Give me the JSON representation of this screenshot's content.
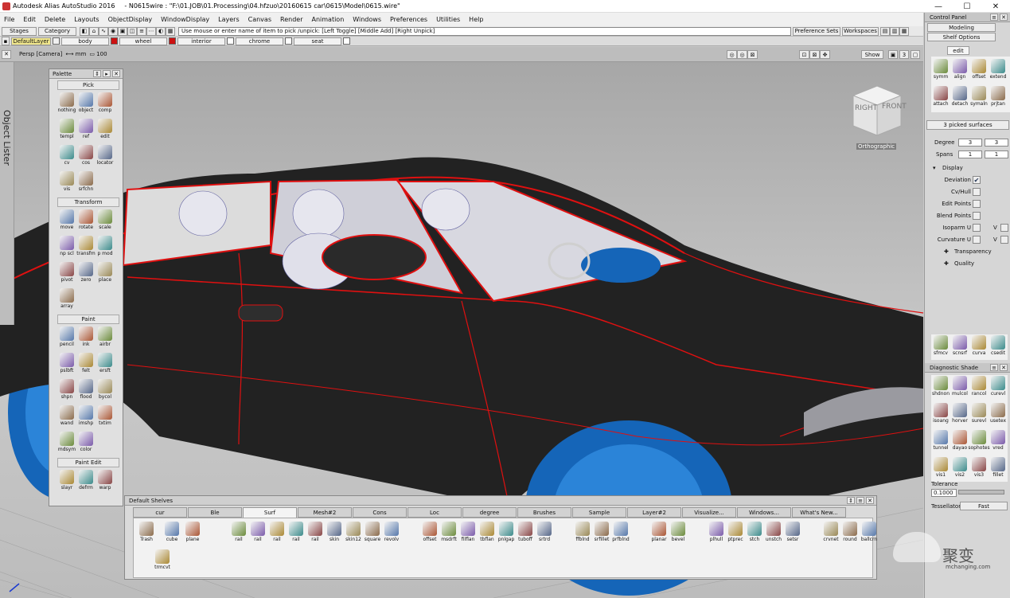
{
  "window": {
    "app_title": "Autodesk Alias AutoStudio 2016",
    "file_title": "- N0615wire : \"F:\\01.JOB\\01.Processing\\04.hfzuo\\20160615 car\\0615\\Model\\0615.wire\"",
    "minimize": "—",
    "maximize": "☐",
    "close": "✕"
  },
  "menu": [
    "File",
    "Edit",
    "Delete",
    "Layouts",
    "ObjectDisplay",
    "WindowDisplay",
    "Layers",
    "Canvas",
    "Render",
    "Animation",
    "Windows",
    "Preferences",
    "Utilities",
    "Help"
  ],
  "toolbar": {
    "stages": "Stages",
    "category": "Category",
    "pick_prompt": "Use mouse or enter name of item to pick /unpick: [Left Toggle] [Middle Add] [Right Unpick]",
    "preference_sets": "Preference Sets",
    "workspaces": "Workspaces"
  },
  "layers": [
    {
      "name": "DefaultLayer",
      "color": "#f0e68c"
    },
    {
      "name": "body",
      "color": "#cc1111"
    },
    {
      "name": "wheel",
      "color": "#cc1111"
    },
    {
      "name": "interior",
      "color": "#ffffff"
    },
    {
      "name": "chrome",
      "color": "#ffffff"
    },
    {
      "name": "seat",
      "color": "#ffffff"
    }
  ],
  "viewport": {
    "camera": "Persp [Camera]",
    "units": "mm",
    "zoom": "100",
    "show_button": "Show",
    "layout_num": "3",
    "viewcube_right": "RIGHT",
    "viewcube_front": "FRONT",
    "view_mode": "Orthographic",
    "colors": {
      "car_body": "#1e1e1e",
      "wire": "#e01010",
      "wheel": "#1e6fc8",
      "seat": "#d8d8e0"
    }
  },
  "object_lister": "Object Lister",
  "palette": {
    "title": "Palette",
    "sections": [
      {
        "name": "Pick",
        "items": [
          "nothing",
          "object",
          "comp",
          "templ",
          "ref",
          "edit",
          "cv",
          "cos",
          "locator",
          "vis",
          "srfchn"
        ]
      },
      {
        "name": "Transform",
        "items": [
          "move",
          "rotate",
          "scale",
          "np scl",
          "transfm",
          "p mod",
          "pivot",
          "zero",
          "place",
          "array"
        ]
      },
      {
        "name": "Paint",
        "items": [
          "pencil",
          "ink",
          "airbr",
          "pslbft",
          "felt",
          "ersft",
          "shpn",
          "flood",
          "bycol",
          "wand",
          "imshp",
          "txtim",
          "mdsym",
          "color"
        ]
      },
      {
        "name": "Paint Edit",
        "items": [
          "slayr",
          "defrm",
          "warp"
        ]
      }
    ]
  },
  "control_panel": {
    "title": "Control Panel",
    "modeling": "Modeling",
    "shelf_options": "Shelf Options",
    "edit_tab": "edit",
    "edit_items": [
      "symm",
      "align",
      "offset",
      "extend",
      "attach",
      "detach",
      "symaln",
      "prjtan"
    ],
    "picked": "3 picked surfaces",
    "degree_label": "Degree",
    "degree_u": "3",
    "degree_v": "3",
    "spans_label": "Spans",
    "spans_u": "1",
    "spans_v": "1",
    "display_label": "Display",
    "display_rows": [
      {
        "label": "Deviation",
        "checked": true,
        "v": false
      },
      {
        "label": "Cv/Hull",
        "checked": false,
        "v": false
      },
      {
        "label": "Edit Points",
        "checked": false,
        "v": false
      },
      {
        "label": "Blend Points",
        "checked": false,
        "v": false
      },
      {
        "label": "Isoparm U",
        "checked": false,
        "v": true
      },
      {
        "label": "Curvature U",
        "checked": false,
        "v": true
      }
    ],
    "v_label": "V",
    "transparency": "Transparency",
    "quality": "Quality",
    "tools_items": [
      "sfmcv",
      "scnsrf",
      "curva",
      "csedit"
    ],
    "diag_title": "Diagnostic Shade",
    "diag_items": [
      "shdnon",
      "mulcol",
      "rancol",
      "curevl",
      "isoang",
      "horver",
      "surevl",
      "usetex",
      "tunnel",
      "dayao",
      "sophotes",
      "vred",
      "vis1",
      "vis2",
      "vis3",
      "fillet"
    ],
    "tolerance_label": "Tolerance",
    "tolerance_value": "0.1000",
    "tessellator_label": "Tessellator",
    "tessellator_value": "Fast"
  },
  "shelves": {
    "title": "Default Shelves",
    "tabs": [
      "cur",
      "Ble",
      "Surf",
      "Mesh#2",
      "Cons",
      "Loc",
      "degree",
      "Brushes",
      "Sample",
      "Layer#2",
      "Visualize...",
      "Windows...",
      "What's New..."
    ],
    "active_tab": "Surf",
    "items_row1": [
      "Trash",
      "cube",
      "plane",
      "rail",
      "rail",
      "rail",
      "rail",
      "rail",
      "skin",
      "skin12",
      "square",
      "revolv",
      "offset",
      "msdrft",
      "filflan",
      "tbflan",
      "pnlgap",
      "tuboff",
      "srtrd",
      "ffblnd",
      "srfillet",
      "prfblnd",
      "planar",
      "bevel",
      "plhull",
      "ptprec",
      "stch",
      "unstch",
      "setsr",
      "crvnet",
      "round",
      "ballcrn"
    ],
    "items_row2": [
      "trmcvt"
    ]
  },
  "watermark": {
    "name": "聚变",
    "url": "mchanging.com"
  }
}
